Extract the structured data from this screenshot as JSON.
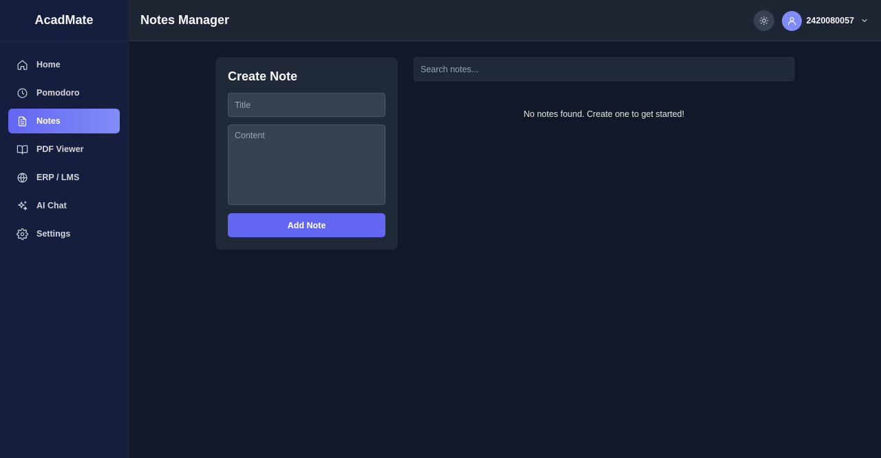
{
  "app": {
    "name": "AcadMate"
  },
  "sidebar": {
    "items": [
      {
        "label": "Home",
        "icon": "home-icon",
        "active": false
      },
      {
        "label": "Pomodoro",
        "icon": "clock-icon",
        "active": false
      },
      {
        "label": "Notes",
        "icon": "file-text-icon",
        "active": true
      },
      {
        "label": "PDF Viewer",
        "icon": "book-open-icon",
        "active": false
      },
      {
        "label": "ERP / LMS",
        "icon": "globe-icon",
        "active": false
      },
      {
        "label": "AI Chat",
        "icon": "sparkles-icon",
        "active": false
      },
      {
        "label": "Settings",
        "icon": "gear-icon",
        "active": false
      }
    ]
  },
  "header": {
    "title": "Notes Manager",
    "theme_icon": "sun-icon",
    "user": {
      "id": "2420080057",
      "avatar_icon": "user-icon",
      "menu_icon": "chevron-down-icon"
    }
  },
  "create_note": {
    "heading": "Create Note",
    "title_placeholder": "Title",
    "title_value": "",
    "content_placeholder": "Content",
    "content_value": "",
    "submit_label": "Add Note"
  },
  "notes_list": {
    "search_placeholder": "Search notes...",
    "search_value": "",
    "empty_message": "No notes found. Create one to get started!"
  },
  "colors": {
    "accent": "#6366f1",
    "accent_light": "#818cf8",
    "sidebar_bg": "#151f3d",
    "main_bg": "#111827",
    "card_bg": "#1f2937"
  }
}
